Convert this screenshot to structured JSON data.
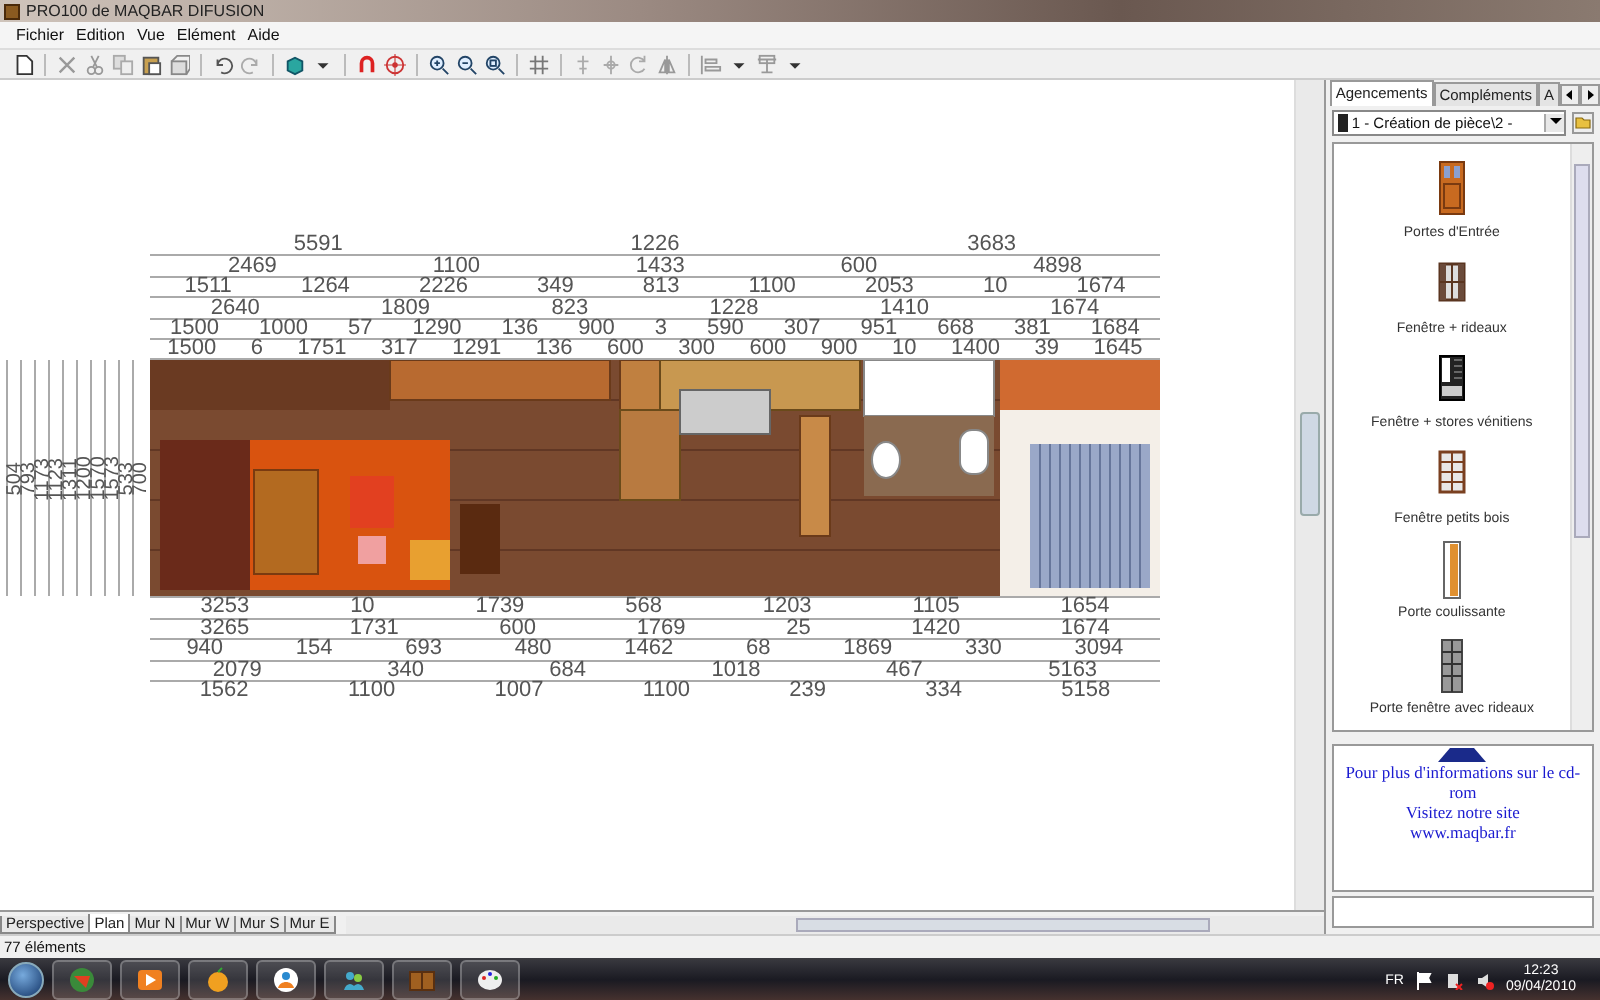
{
  "window": {
    "title": "PRO100 de MAQBAR DIFUSION"
  },
  "menu": [
    {
      "label": "Fichier"
    },
    {
      "label": "Edition"
    },
    {
      "label": "Vue"
    },
    {
      "label": "Elément"
    },
    {
      "label": "Aide"
    }
  ],
  "plan": {
    "top_dimensions": [
      [
        "5591",
        "1226",
        "3683"
      ],
      [
        "2469",
        "1100",
        "1433",
        "600",
        "4898"
      ],
      [
        "1511",
        "1264",
        "2226",
        "349",
        "813",
        "1100",
        "2053",
        "10",
        "1674"
      ],
      [
        "2640",
        "1809",
        "823",
        "1228",
        "1410",
        "1674"
      ],
      [
        "1500",
        "1000",
        "57",
        "1290",
        "136",
        "900",
        "3",
        "590",
        "307",
        "951",
        "668",
        "381",
        "1684"
      ],
      [
        "1500",
        "6",
        "1751",
        "317",
        "1291",
        "136",
        "600",
        "300",
        "600",
        "900",
        "10",
        "1400",
        "39",
        "1645"
      ]
    ],
    "side_dimensions": [
      "504",
      "793",
      "1173",
      "1123",
      "1311",
      "1200",
      "1570",
      "1573",
      "533",
      "700"
    ],
    "bottom_dimensions": [
      [
        "3253",
        "10",
        "1739",
        "568",
        "1203",
        "1105",
        "1654"
      ],
      [
        "3265",
        "1731",
        "600",
        "1769",
        "25",
        "1420",
        "1674"
      ],
      [
        "940",
        "154",
        "693",
        "480",
        "1462",
        "68",
        "1869",
        "330",
        "3094"
      ],
      [
        "2079",
        "340",
        "684",
        "1018",
        "467",
        "5163"
      ],
      [
        "1562",
        "1100",
        "1007",
        "1100",
        "239",
        "334",
        "5158"
      ]
    ]
  },
  "view_tabs": [
    {
      "label": "Perspective",
      "selected": false
    },
    {
      "label": "Plan",
      "selected": true
    },
    {
      "label": "Mur N",
      "selected": false
    },
    {
      "label": "Mur W",
      "selected": false
    },
    {
      "label": "Mur S",
      "selected": false
    },
    {
      "label": "Mur E",
      "selected": false
    }
  ],
  "panel": {
    "tabs": [
      {
        "label": "Agencements",
        "selected": true
      },
      {
        "label": "Compléments",
        "selected": false
      },
      {
        "label": "A",
        "selected": false
      }
    ],
    "dropdown": {
      "value": "1 - Création de pièce\\2 -"
    },
    "items": [
      {
        "label": "Portes d'Entrée",
        "kind": "entry-door"
      },
      {
        "label": "Fenêtre + rideaux",
        "kind": "curtain-window"
      },
      {
        "label": "Fenêtre + stores vénitiens",
        "kind": "blind-window"
      },
      {
        "label": "Fenêtre petits bois",
        "kind": "grid-window"
      },
      {
        "label": "Porte coulissante",
        "kind": "sliding-door"
      },
      {
        "label": "Porte fenêtre avec rideaux",
        "kind": "french-door"
      }
    ],
    "ad": {
      "lines": [
        "Pour plus d'informations sur le cd-rom",
        "Visitez notre site",
        "www.maqbar.fr"
      ]
    }
  },
  "status_bar": {
    "text": "77 éléments"
  },
  "taskbar": {
    "language": "FR",
    "time": "12:23",
    "date": "09/04/2010"
  }
}
